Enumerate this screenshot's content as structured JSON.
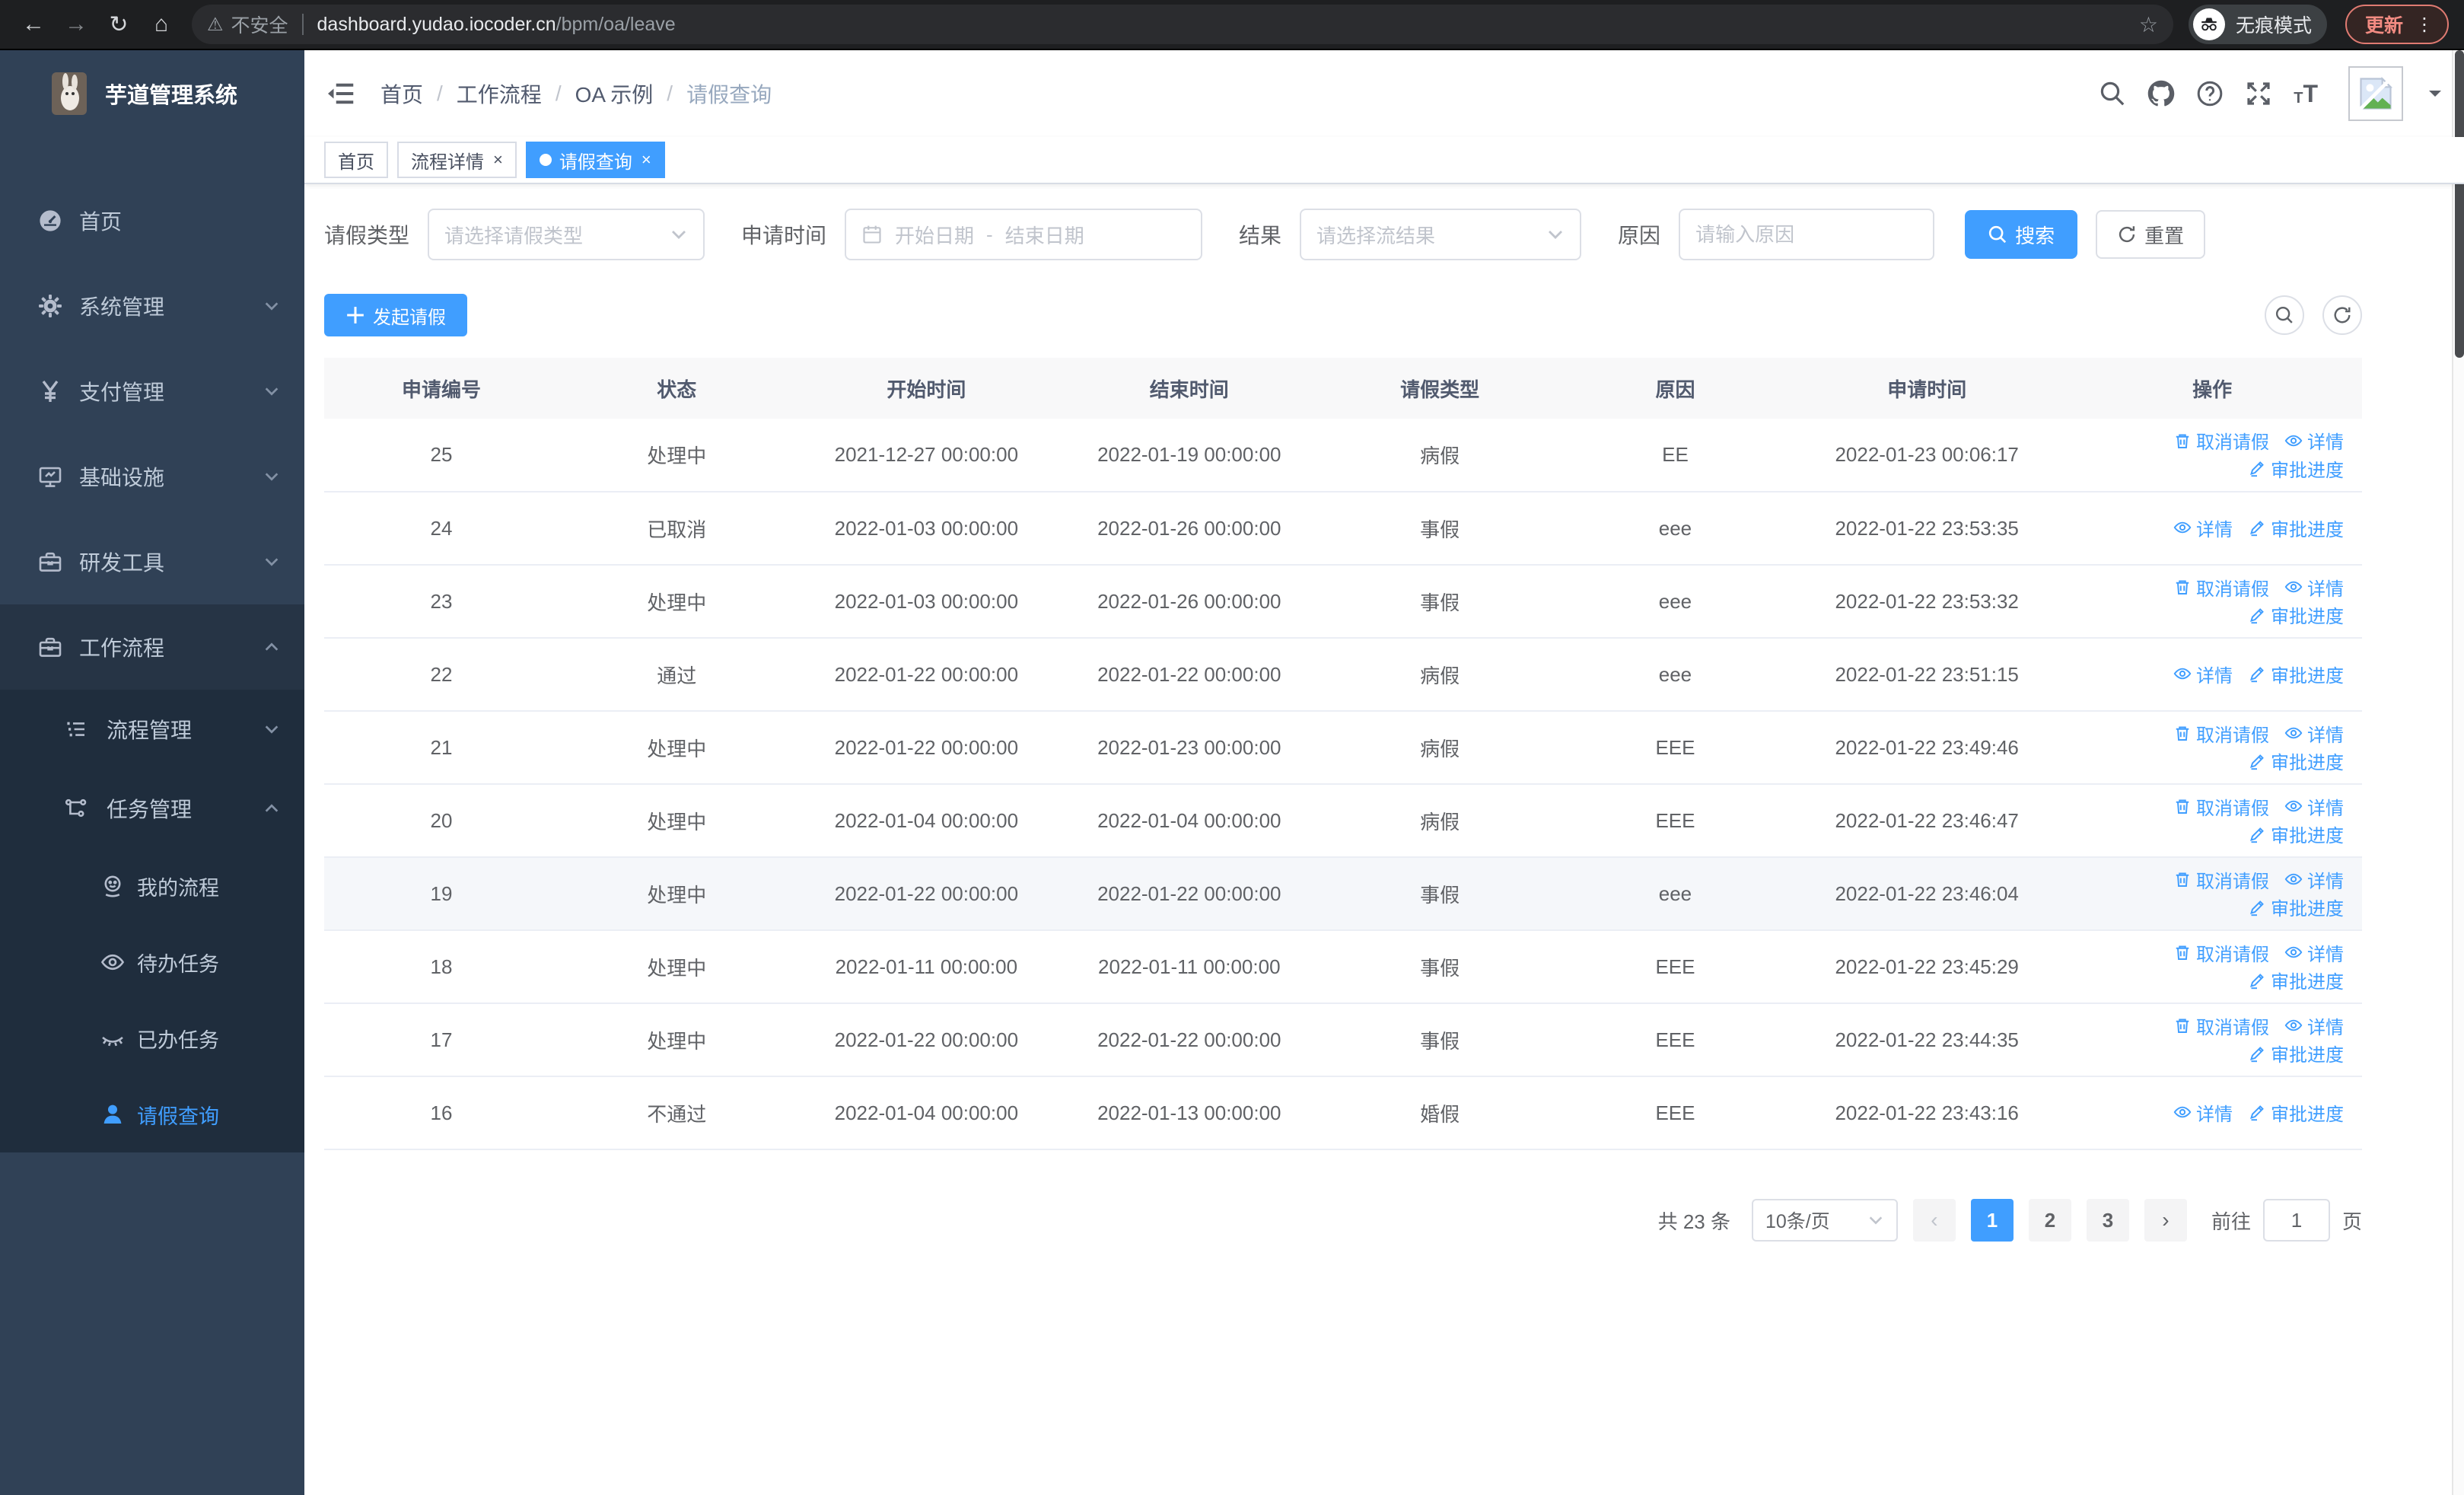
{
  "browser": {
    "back": "←",
    "forward": "→",
    "reload": "↻",
    "home": "⌂",
    "security_label": "不安全",
    "url_host": "dashboard.yudao.iocoder.cn",
    "url_path": "/bpm/oa/leave",
    "star": "☆",
    "incognito_label": "无痕模式",
    "update_label": "更新",
    "kebab": "⋮"
  },
  "header": {
    "logo_title": "芋道管理系统",
    "breadcrumb": [
      "首页",
      "工作流程",
      "OA 示例",
      "请假查询"
    ]
  },
  "tabs": [
    {
      "label": "首页",
      "closable": false,
      "active": false
    },
    {
      "label": "流程详情",
      "closable": true,
      "active": false
    },
    {
      "label": "请假查询",
      "closable": true,
      "active": true
    }
  ],
  "sidebar": {
    "items": [
      {
        "key": "home",
        "label": "首页",
        "icon": "dashboard",
        "level": 1,
        "arrow": "",
        "active": false,
        "open": false
      },
      {
        "key": "system",
        "label": "系统管理",
        "icon": "gear",
        "level": 1,
        "arrow": "down",
        "active": false,
        "open": false
      },
      {
        "key": "payment",
        "label": "支付管理",
        "icon": "yen",
        "level": 1,
        "arrow": "down",
        "active": false,
        "open": false
      },
      {
        "key": "infra",
        "label": "基础设施",
        "icon": "monitor",
        "level": 1,
        "arrow": "down",
        "active": false,
        "open": false
      },
      {
        "key": "devtools",
        "label": "研发工具",
        "icon": "toolbox",
        "level": 1,
        "arrow": "down",
        "active": false,
        "open": false
      },
      {
        "key": "workflow",
        "label": "工作流程",
        "icon": "toolbox",
        "level": 1,
        "arrow": "up",
        "active": false,
        "open": true
      },
      {
        "key": "process-mgmt",
        "label": "流程管理",
        "icon": "listtree",
        "level": 2,
        "arrow": "down",
        "active": false,
        "open": false
      },
      {
        "key": "task-mgmt",
        "label": "任务管理",
        "icon": "branch",
        "level": 2,
        "arrow": "up",
        "active": false,
        "open": false
      },
      {
        "key": "my-process",
        "label": "我的流程",
        "icon": "face",
        "level": 3,
        "arrow": "",
        "active": false,
        "open": false
      },
      {
        "key": "todo-tasks",
        "label": "待办任务",
        "icon": "eye",
        "level": 3,
        "arrow": "",
        "active": false,
        "open": false
      },
      {
        "key": "done-tasks",
        "label": "已办任务",
        "icon": "eyeclosed",
        "level": 3,
        "arrow": "",
        "active": false,
        "open": false
      },
      {
        "key": "leave-query",
        "label": "请假查询",
        "icon": "person",
        "level": 3,
        "arrow": "",
        "active": true,
        "open": false
      }
    ]
  },
  "filters": {
    "leave_type": {
      "label": "请假类型",
      "placeholder": "请选择请假类型"
    },
    "apply_time": {
      "label": "申请时间",
      "start_placeholder": "开始日期",
      "separator": "-",
      "end_placeholder": "结束日期"
    },
    "result": {
      "label": "结果",
      "placeholder": "请选择流结果"
    },
    "reason": {
      "label": "原因",
      "placeholder": "请输入原因"
    },
    "search_label": "搜索",
    "reset_label": "重置"
  },
  "toolbar": {
    "create_label": "发起请假"
  },
  "table": {
    "headers": [
      "申请编号",
      "状态",
      "开始时间",
      "结束时间",
      "请假类型",
      "原因",
      "申请时间",
      "操作"
    ],
    "col_widths": [
      "11.5%",
      "11.6%",
      "12.9%",
      "12.9%",
      "11.7%",
      "11.4%",
      "13.3%",
      "14.7%"
    ],
    "action_labels": {
      "cancel": "取消请假",
      "detail": "详情",
      "progress": "审批进度"
    },
    "rows": [
      {
        "id": "25",
        "status": "处理中",
        "start": "2021-12-27 00:00:00",
        "end": "2022-01-19 00:00:00",
        "type": "病假",
        "reason": "EE",
        "applied": "2022-01-23 00:06:17",
        "actions": [
          "cancel",
          "detail",
          "progress"
        ],
        "highlight": false
      },
      {
        "id": "24",
        "status": "已取消",
        "start": "2022-01-03 00:00:00",
        "end": "2022-01-26 00:00:00",
        "type": "事假",
        "reason": "eee",
        "applied": "2022-01-22 23:53:35",
        "actions": [
          "detail",
          "progress"
        ],
        "highlight": false
      },
      {
        "id": "23",
        "status": "处理中",
        "start": "2022-01-03 00:00:00",
        "end": "2022-01-26 00:00:00",
        "type": "事假",
        "reason": "eee",
        "applied": "2022-01-22 23:53:32",
        "actions": [
          "cancel",
          "detail",
          "progress"
        ],
        "highlight": false
      },
      {
        "id": "22",
        "status": "通过",
        "start": "2022-01-22 00:00:00",
        "end": "2022-01-22 00:00:00",
        "type": "病假",
        "reason": "eee",
        "applied": "2022-01-22 23:51:15",
        "actions": [
          "detail",
          "progress"
        ],
        "highlight": false
      },
      {
        "id": "21",
        "status": "处理中",
        "start": "2022-01-22 00:00:00",
        "end": "2022-01-23 00:00:00",
        "type": "病假",
        "reason": "EEE",
        "applied": "2022-01-22 23:49:46",
        "actions": [
          "cancel",
          "detail",
          "progress"
        ],
        "highlight": false
      },
      {
        "id": "20",
        "status": "处理中",
        "start": "2022-01-04 00:00:00",
        "end": "2022-01-04 00:00:00",
        "type": "病假",
        "reason": "EEE",
        "applied": "2022-01-22 23:46:47",
        "actions": [
          "cancel",
          "detail",
          "progress"
        ],
        "highlight": false
      },
      {
        "id": "19",
        "status": "处理中",
        "start": "2022-01-22 00:00:00",
        "end": "2022-01-22 00:00:00",
        "type": "事假",
        "reason": "eee",
        "applied": "2022-01-22 23:46:04",
        "actions": [
          "cancel",
          "detail",
          "progress"
        ],
        "highlight": true
      },
      {
        "id": "18",
        "status": "处理中",
        "start": "2022-01-11 00:00:00",
        "end": "2022-01-11 00:00:00",
        "type": "事假",
        "reason": "EEE",
        "applied": "2022-01-22 23:45:29",
        "actions": [
          "cancel",
          "detail",
          "progress"
        ],
        "highlight": false
      },
      {
        "id": "17",
        "status": "处理中",
        "start": "2022-01-22 00:00:00",
        "end": "2022-01-22 00:00:00",
        "type": "事假",
        "reason": "EEE",
        "applied": "2022-01-22 23:44:35",
        "actions": [
          "cancel",
          "detail",
          "progress"
        ],
        "highlight": false
      },
      {
        "id": "16",
        "status": "不通过",
        "start": "2022-01-04 00:00:00",
        "end": "2022-01-13 00:00:00",
        "type": "婚假",
        "reason": "EEE",
        "applied": "2022-01-22 23:43:16",
        "actions": [
          "detail",
          "progress"
        ],
        "highlight": false
      }
    ]
  },
  "pagination": {
    "total_label": "共 23 条",
    "page_size_label": "10条/页",
    "prev": "‹",
    "next": "›",
    "pages": [
      "1",
      "2",
      "3"
    ],
    "current_page": "1",
    "goto_label": "前往",
    "goto_value": "1",
    "goto_suffix": "页"
  },
  "colors": {
    "primary": "#409EFF",
    "sidebar": "#304156",
    "submenu": "#1f2d3d"
  }
}
